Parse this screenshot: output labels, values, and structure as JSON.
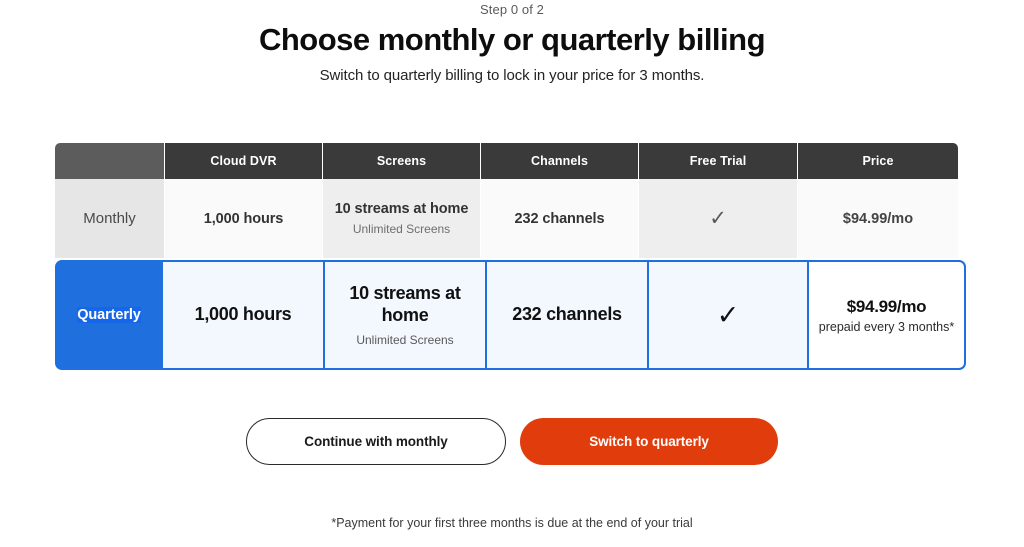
{
  "header": {
    "step_label": "Step 0 of 2",
    "title": "Choose monthly or quarterly billing",
    "subtitle": "Switch to quarterly billing to lock in your price for 3 months."
  },
  "table": {
    "columns": [
      {
        "key": "plan",
        "label": ""
      },
      {
        "key": "cloud_dvr",
        "label": "Cloud DVR"
      },
      {
        "key": "screens",
        "label": "Screens"
      },
      {
        "key": "channels",
        "label": "Channels"
      },
      {
        "key": "free_trial",
        "label": "Free Trial"
      },
      {
        "key": "price",
        "label": "Price"
      }
    ],
    "monthly": {
      "plan_label": "Monthly",
      "cloud_dvr": "1,000 hours",
      "screens_main": "10 streams at home",
      "screens_sub": "Unlimited Screens",
      "channels": "232 channels",
      "free_trial_icon": "checkmark-icon",
      "free_trial_glyph": "✓",
      "price": "$94.99/mo"
    },
    "quarterly": {
      "plan_label": "Quarterly",
      "cloud_dvr": "1,000 hours",
      "screens_main": "10 streams at home",
      "screens_sub": "Unlimited Screens",
      "channels": "232 channels",
      "free_trial_icon": "checkmark-icon",
      "free_trial_glyph": "✓",
      "price": "$94.99/mo",
      "price_sub": "prepaid every 3 months*"
    }
  },
  "actions": {
    "continue_monthly": "Continue with monthly",
    "switch_quarterly": "Switch to quarterly"
  },
  "footnote": "*Payment for your first three months is due at the end of your trial",
  "colors": {
    "highlight_blue": "#1f6fdf",
    "primary_button": "#e03c0c",
    "header_dark": "#3a3a3a",
    "header_first": "#5c5c5c"
  }
}
